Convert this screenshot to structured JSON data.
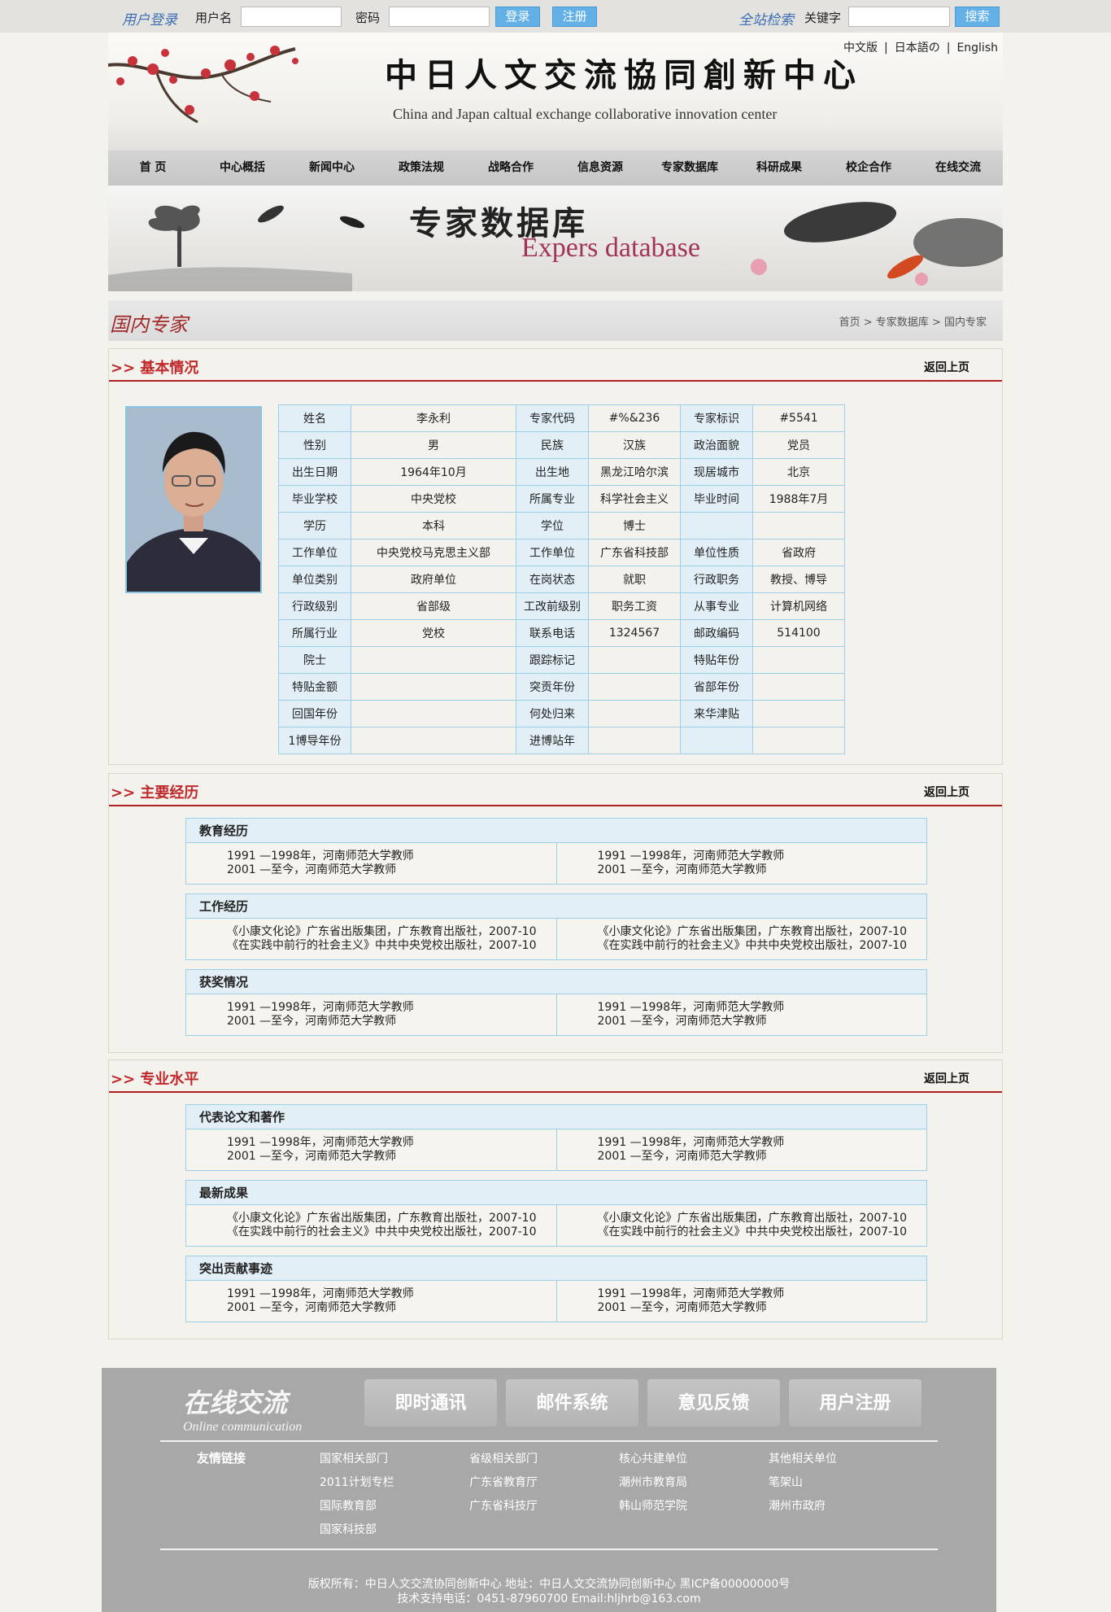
{
  "topbar": {
    "login_label": "用户登录",
    "username_label": "用户名",
    "password_label": "密码",
    "login_btn": "登录",
    "register_btn": "注册",
    "search_label": "全站检索",
    "keyword_label": "关键字",
    "search_btn": "搜索"
  },
  "header": {
    "title_cn": "中日人文交流協同創新中心",
    "title_en": "China and Japan caltual exchange collaborative innovation center",
    "lang_cn": "中文版",
    "lang_sep1": "|",
    "lang_jp": "日本語の",
    "lang_sep2": "|",
    "lang_en": "English"
  },
  "nav": [
    "首 页",
    "中心概括",
    "新闻中心",
    "政策法规",
    "战略合作",
    "信息资源",
    "专家数据库",
    "科研成果",
    "校企合作",
    "在线交流"
  ],
  "banner": {
    "title_cn": "专家数据库",
    "title_en": "Expers database"
  },
  "page": {
    "title": "国内专家",
    "crumb1": "首页",
    "crumb2": "专家数据库",
    "crumb3": "国内专家",
    "sep": ">"
  },
  "basic": {
    "title": ">> 基本情况",
    "back": "返回上页",
    "rows": [
      [
        "姓名",
        "李永利",
        "专家代码",
        "#%&236",
        "专家标识",
        "#5541"
      ],
      [
        "性别",
        "男",
        "民族",
        "汉族",
        "政治面貌",
        "党员"
      ],
      [
        "出生日期",
        "1964年10月",
        "出生地",
        "黑龙江哈尔滨",
        "现居城市",
        "北京"
      ],
      [
        "毕业学校",
        "中央党校",
        "所属专业",
        "科学社会主义",
        "毕业时间",
        "1988年7月"
      ],
      [
        "学历",
        "本科",
        "学位",
        "博士",
        "",
        ""
      ],
      [
        "工作单位",
        "中央党校马克思主义部",
        "工作单位",
        "广东省科技部",
        "单位性质",
        "省政府"
      ],
      [
        "单位类别",
        "政府单位",
        "在岗状态",
        "就职",
        "行政职务",
        "教授、博导"
      ],
      [
        "行政级别",
        "省部级",
        "工改前级别",
        "职务工资",
        "从事专业",
        "计算机网络"
      ],
      [
        "所属行业",
        "党校",
        "联系电话",
        "1324567",
        "邮政编码",
        "514100"
      ],
      [
        "院士",
        "",
        "跟踪标记",
        "",
        "特贴年份",
        ""
      ],
      [
        "特贴金额",
        "",
        "突贡年份",
        "",
        "省部年份",
        ""
      ],
      [
        "回国年份",
        "",
        "何处归来",
        "",
        "来华津贴",
        ""
      ],
      [
        "1博导年份",
        "",
        "进博站年",
        "",
        "",
        ""
      ]
    ]
  },
  "history": {
    "title": ">> 主要经历",
    "back": "返回上页",
    "boxes": [
      {
        "title": "教育经历",
        "left": [
          "1991 —1998年，河南师范大学教师",
          "2001 —至今，河南师范大学教师"
        ],
        "right": [
          "1991 —1998年，河南师范大学教师",
          "2001 —至今，河南师范大学教师"
        ]
      },
      {
        "title": "工作经历",
        "left": [
          "《小康文化论》广东省出版集团，广东教育出版社，2007-10",
          "《在实践中前行的社会主义》中共中央党校出版社，2007-10"
        ],
        "right": [
          "《小康文化论》广东省出版集团，广东教育出版社，2007-10",
          "《在实践中前行的社会主义》中共中央党校出版社，2007-10"
        ]
      },
      {
        "title": "获奖情况",
        "left": [
          "1991 —1998年，河南师范大学教师",
          "2001 —至今，河南师范大学教师"
        ],
        "right": [
          "1991 —1998年，河南师范大学教师",
          "2001 —至今，河南师范大学教师"
        ]
      }
    ]
  },
  "level": {
    "title": ">> 专业水平",
    "back": "返回上页",
    "boxes": [
      {
        "title": "代表论文和著作",
        "left": [
          "1991 —1998年，河南师范大学教师",
          "2001 —至今，河南师范大学教师"
        ],
        "right": [
          "1991 —1998年，河南师范大学教师",
          "2001 —至今，河南师范大学教师"
        ]
      },
      {
        "title": "最新成果",
        "left": [
          "《小康文化论》广东省出版集团，广东教育出版社，2007-10",
          "《在实践中前行的社会主义》中共中央党校出版社，2007-10"
        ],
        "right": [
          "《小康文化论》广东省出版集团，广东教育出版社，2007-10",
          "《在实践中前行的社会主义》中共中央党校出版社，2007-10"
        ]
      },
      {
        "title": "突出贡献事迹",
        "left": [
          "1991 —1998年，河南师范大学教师",
          "2001 —至今，河南师范大学教师"
        ],
        "right": [
          "1991 —1998年，河南师范大学教师",
          "2001 —至今，河南师范大学教师"
        ]
      }
    ]
  },
  "footer": {
    "logo_cn": "在线交流",
    "logo_en": "Online communication",
    "buttons": [
      "即时通讯",
      "邮件系统",
      "意见反馈",
      "用户注册"
    ],
    "links_title": "友情链接",
    "links": [
      [
        "国家相关部门",
        "2011计划专栏",
        "国际教育部",
        "国家科技部"
      ],
      [
        "省级相关部门",
        "广东省教育厅",
        "广东省科技厅"
      ],
      [
        "核心共建单位",
        "潮州市教育局",
        "韩山师范学院"
      ],
      [
        "其他相关单位",
        "笔架山",
        "潮州市政府"
      ]
    ],
    "copyright": "版权所有：中日人文交流协同创新中心  地址：中日人文交流协同创新中心 黑ICP备00000000号",
    "support": "技术支持电话：0451-87960700 Email:hljhrb@163.com"
  }
}
